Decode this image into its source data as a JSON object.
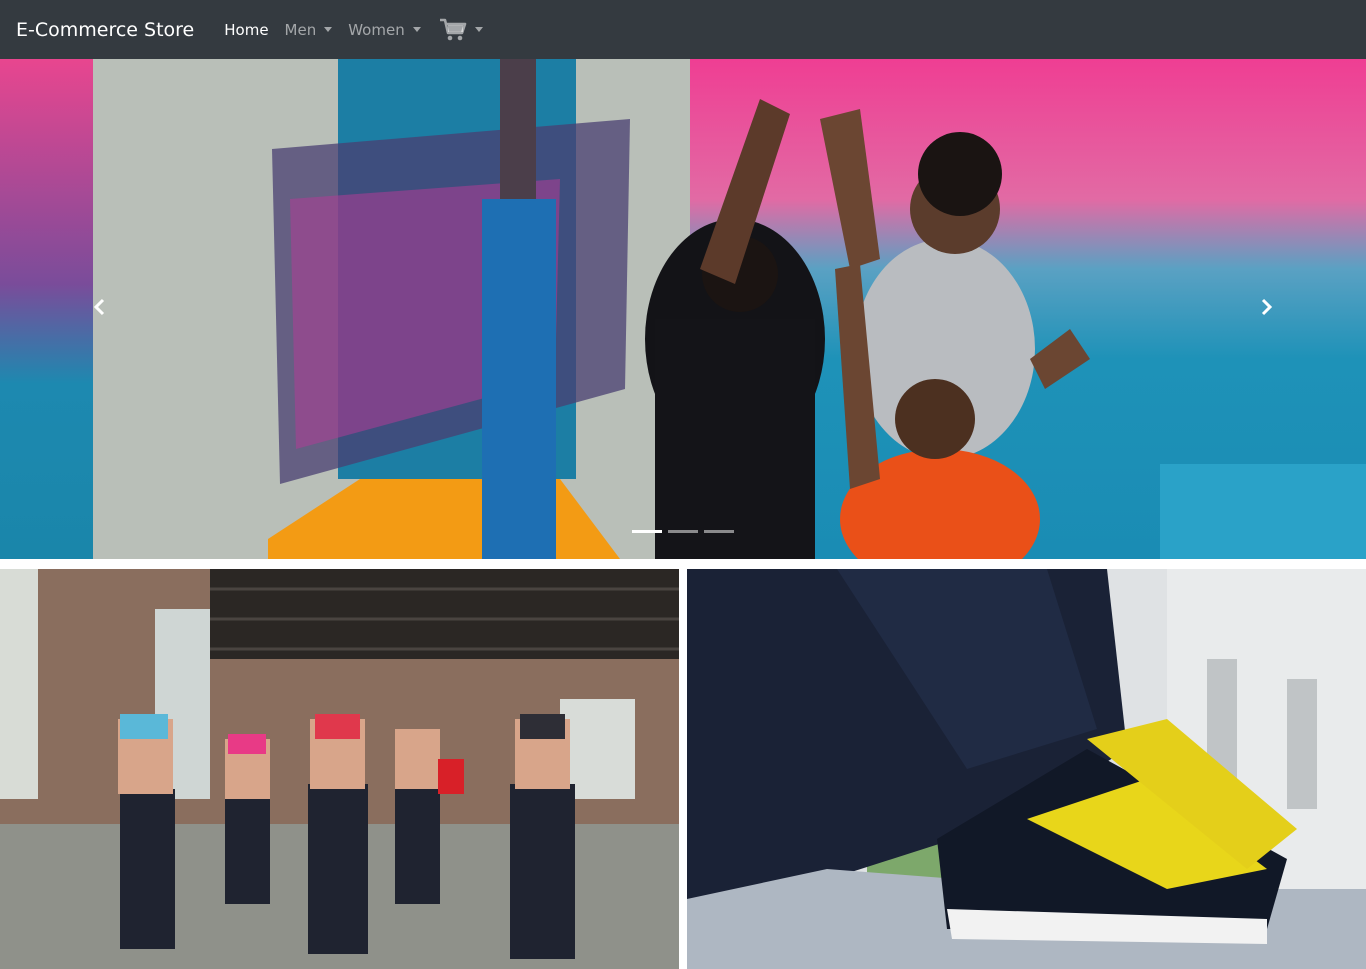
{
  "navbar": {
    "brand": "E-Commerce Store",
    "links": [
      {
        "label": "Home",
        "active": true
      },
      {
        "label": "Men",
        "dropdown": true
      },
      {
        "label": "Women",
        "dropdown": true
      }
    ],
    "cart": {
      "icon": "shopping-cart-icon",
      "dropdown": true
    }
  },
  "carousel": {
    "slide_count": 3,
    "active_slide": 1,
    "prev_icon": "chevron-left-icon",
    "next_icon": "chevron-right-icon"
  },
  "images": {
    "left_banner": {
      "role": "category-banner"
    },
    "right_banner": {
      "role": "category-banner"
    }
  },
  "colors": {
    "navbar_bg": "#343a40",
    "nav_active": "#ffffff",
    "nav_inactive": "rgba(255,255,255,0.55)"
  }
}
